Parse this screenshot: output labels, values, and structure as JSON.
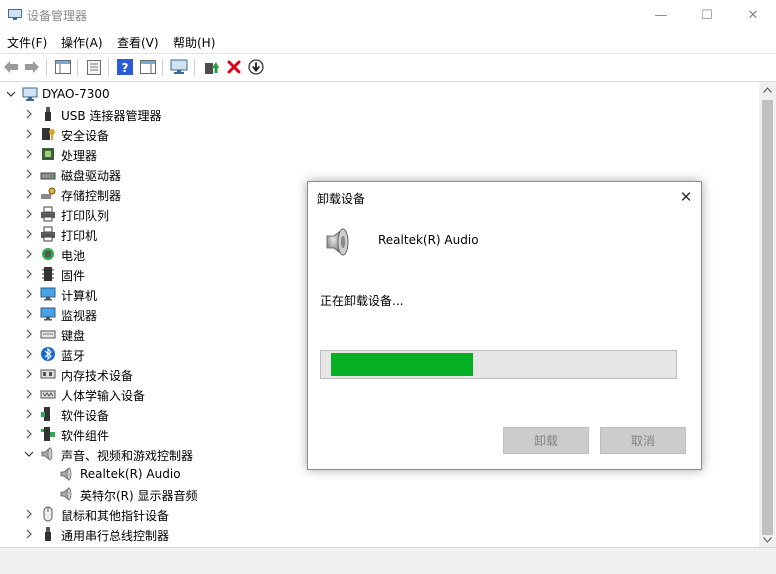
{
  "window": {
    "title": "设备管理器"
  },
  "window_controls": {
    "minimize": "—",
    "maximize": "☐",
    "close": "✕"
  },
  "menu": [
    "文件(F)",
    "操作(A)",
    "查看(V)",
    "帮助(H)"
  ],
  "tree": {
    "root": "DYAO-7300",
    "items": [
      {
        "label": "USB 连接器管理器",
        "icon": "usb-icon"
      },
      {
        "label": "安全设备",
        "icon": "key-icon"
      },
      {
        "label": "处理器",
        "icon": "cpu-icon"
      },
      {
        "label": "磁盘驱动器",
        "icon": "disk-icon"
      },
      {
        "label": "存储控制器",
        "icon": "storage-icon"
      },
      {
        "label": "打印队列",
        "icon": "printer-icon"
      },
      {
        "label": "打印机",
        "icon": "printer-icon"
      },
      {
        "label": "电池",
        "icon": "battery-icon"
      },
      {
        "label": "固件",
        "icon": "chip-icon"
      },
      {
        "label": "计算机",
        "icon": "monitor-icon"
      },
      {
        "label": "监视器",
        "icon": "monitor-icon"
      },
      {
        "label": "键盘",
        "icon": "keyboard-icon"
      },
      {
        "label": "蓝牙",
        "icon": "bluetooth-icon"
      },
      {
        "label": "内存技术设备",
        "icon": "memory-icon"
      },
      {
        "label": "人体学输入设备",
        "icon": "hid-icon"
      },
      {
        "label": "软件设备",
        "icon": "software-icon"
      },
      {
        "label": "软件组件",
        "icon": "component-icon"
      },
      {
        "label": "声音、视频和游戏控制器",
        "icon": "speaker-icon",
        "expanded": true
      },
      {
        "label": "Realtek(R) Audio",
        "icon": "speaker-icon",
        "child": true
      },
      {
        "label": "英特尔(R) 显示器音频",
        "icon": "speaker-icon",
        "child": true
      },
      {
        "label": "鼠标和其他指针设备",
        "icon": "mouse-icon"
      },
      {
        "label": "通用串行总线控制器",
        "icon": "usb-icon"
      }
    ]
  },
  "dialog": {
    "title": "卸载设备",
    "close": "✕",
    "device_name": "Realtek(R) Audio",
    "status": "正在卸载设备...",
    "progress": 0.4,
    "uninstall_button": "卸载",
    "cancel_button": "取消"
  },
  "colors": {
    "progress": "#06b025",
    "help_icon": "#2d5bd6",
    "delete_icon": "#d9001b"
  }
}
